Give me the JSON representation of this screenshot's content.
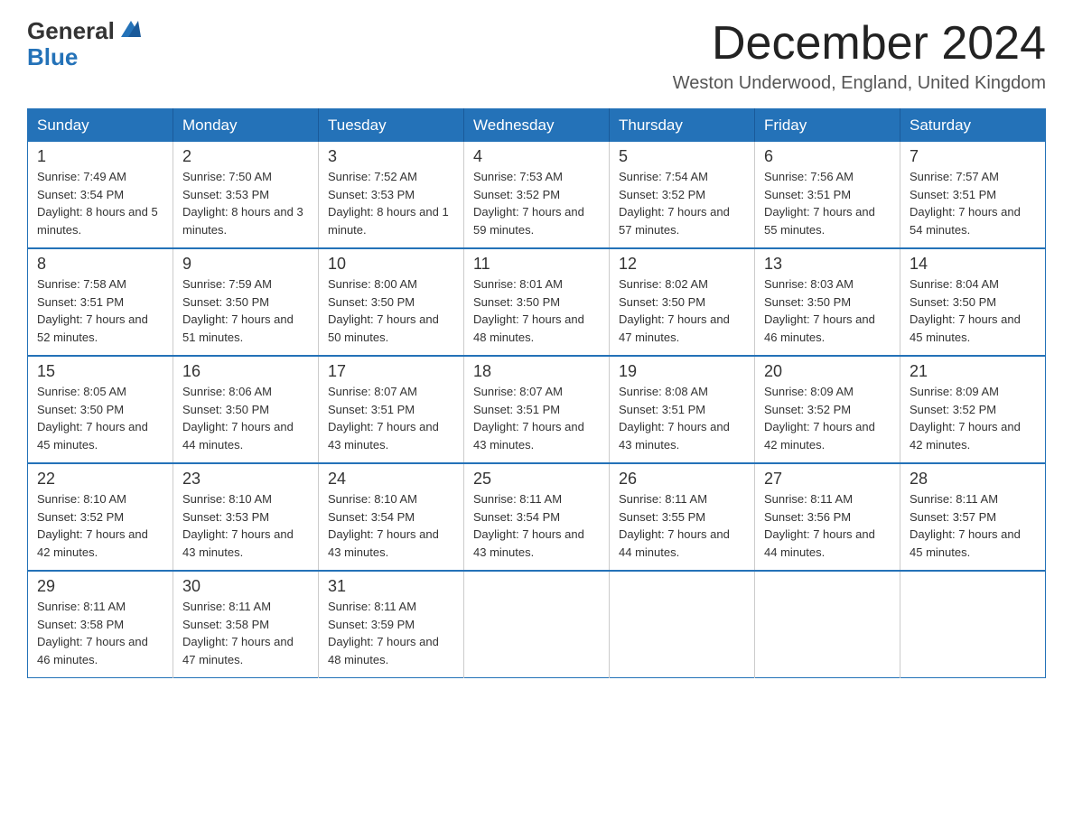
{
  "logo": {
    "general": "General",
    "blue": "Blue"
  },
  "title": {
    "month": "December 2024",
    "location": "Weston Underwood, England, United Kingdom"
  },
  "weekdays": [
    "Sunday",
    "Monday",
    "Tuesday",
    "Wednesday",
    "Thursday",
    "Friday",
    "Saturday"
  ],
  "weeks": [
    [
      {
        "day": "1",
        "sunrise": "7:49 AM",
        "sunset": "3:54 PM",
        "daylight": "8 hours and 5 minutes."
      },
      {
        "day": "2",
        "sunrise": "7:50 AM",
        "sunset": "3:53 PM",
        "daylight": "8 hours and 3 minutes."
      },
      {
        "day": "3",
        "sunrise": "7:52 AM",
        "sunset": "3:53 PM",
        "daylight": "8 hours and 1 minute."
      },
      {
        "day": "4",
        "sunrise": "7:53 AM",
        "sunset": "3:52 PM",
        "daylight": "7 hours and 59 minutes."
      },
      {
        "day": "5",
        "sunrise": "7:54 AM",
        "sunset": "3:52 PM",
        "daylight": "7 hours and 57 minutes."
      },
      {
        "day": "6",
        "sunrise": "7:56 AM",
        "sunset": "3:51 PM",
        "daylight": "7 hours and 55 minutes."
      },
      {
        "day": "7",
        "sunrise": "7:57 AM",
        "sunset": "3:51 PM",
        "daylight": "7 hours and 54 minutes."
      }
    ],
    [
      {
        "day": "8",
        "sunrise": "7:58 AM",
        "sunset": "3:51 PM",
        "daylight": "7 hours and 52 minutes."
      },
      {
        "day": "9",
        "sunrise": "7:59 AM",
        "sunset": "3:50 PM",
        "daylight": "7 hours and 51 minutes."
      },
      {
        "day": "10",
        "sunrise": "8:00 AM",
        "sunset": "3:50 PM",
        "daylight": "7 hours and 50 minutes."
      },
      {
        "day": "11",
        "sunrise": "8:01 AM",
        "sunset": "3:50 PM",
        "daylight": "7 hours and 48 minutes."
      },
      {
        "day": "12",
        "sunrise": "8:02 AM",
        "sunset": "3:50 PM",
        "daylight": "7 hours and 47 minutes."
      },
      {
        "day": "13",
        "sunrise": "8:03 AM",
        "sunset": "3:50 PM",
        "daylight": "7 hours and 46 minutes."
      },
      {
        "day": "14",
        "sunrise": "8:04 AM",
        "sunset": "3:50 PM",
        "daylight": "7 hours and 45 minutes."
      }
    ],
    [
      {
        "day": "15",
        "sunrise": "8:05 AM",
        "sunset": "3:50 PM",
        "daylight": "7 hours and 45 minutes."
      },
      {
        "day": "16",
        "sunrise": "8:06 AM",
        "sunset": "3:50 PM",
        "daylight": "7 hours and 44 minutes."
      },
      {
        "day": "17",
        "sunrise": "8:07 AM",
        "sunset": "3:51 PM",
        "daylight": "7 hours and 43 minutes."
      },
      {
        "day": "18",
        "sunrise": "8:07 AM",
        "sunset": "3:51 PM",
        "daylight": "7 hours and 43 minutes."
      },
      {
        "day": "19",
        "sunrise": "8:08 AM",
        "sunset": "3:51 PM",
        "daylight": "7 hours and 43 minutes."
      },
      {
        "day": "20",
        "sunrise": "8:09 AM",
        "sunset": "3:52 PM",
        "daylight": "7 hours and 42 minutes."
      },
      {
        "day": "21",
        "sunrise": "8:09 AM",
        "sunset": "3:52 PM",
        "daylight": "7 hours and 42 minutes."
      }
    ],
    [
      {
        "day": "22",
        "sunrise": "8:10 AM",
        "sunset": "3:52 PM",
        "daylight": "7 hours and 42 minutes."
      },
      {
        "day": "23",
        "sunrise": "8:10 AM",
        "sunset": "3:53 PM",
        "daylight": "7 hours and 43 minutes."
      },
      {
        "day": "24",
        "sunrise": "8:10 AM",
        "sunset": "3:54 PM",
        "daylight": "7 hours and 43 minutes."
      },
      {
        "day": "25",
        "sunrise": "8:11 AM",
        "sunset": "3:54 PM",
        "daylight": "7 hours and 43 minutes."
      },
      {
        "day": "26",
        "sunrise": "8:11 AM",
        "sunset": "3:55 PM",
        "daylight": "7 hours and 44 minutes."
      },
      {
        "day": "27",
        "sunrise": "8:11 AM",
        "sunset": "3:56 PM",
        "daylight": "7 hours and 44 minutes."
      },
      {
        "day": "28",
        "sunrise": "8:11 AM",
        "sunset": "3:57 PM",
        "daylight": "7 hours and 45 minutes."
      }
    ],
    [
      {
        "day": "29",
        "sunrise": "8:11 AM",
        "sunset": "3:58 PM",
        "daylight": "7 hours and 46 minutes."
      },
      {
        "day": "30",
        "sunrise": "8:11 AM",
        "sunset": "3:58 PM",
        "daylight": "7 hours and 47 minutes."
      },
      {
        "day": "31",
        "sunrise": "8:11 AM",
        "sunset": "3:59 PM",
        "daylight": "7 hours and 48 minutes."
      },
      null,
      null,
      null,
      null
    ]
  ]
}
